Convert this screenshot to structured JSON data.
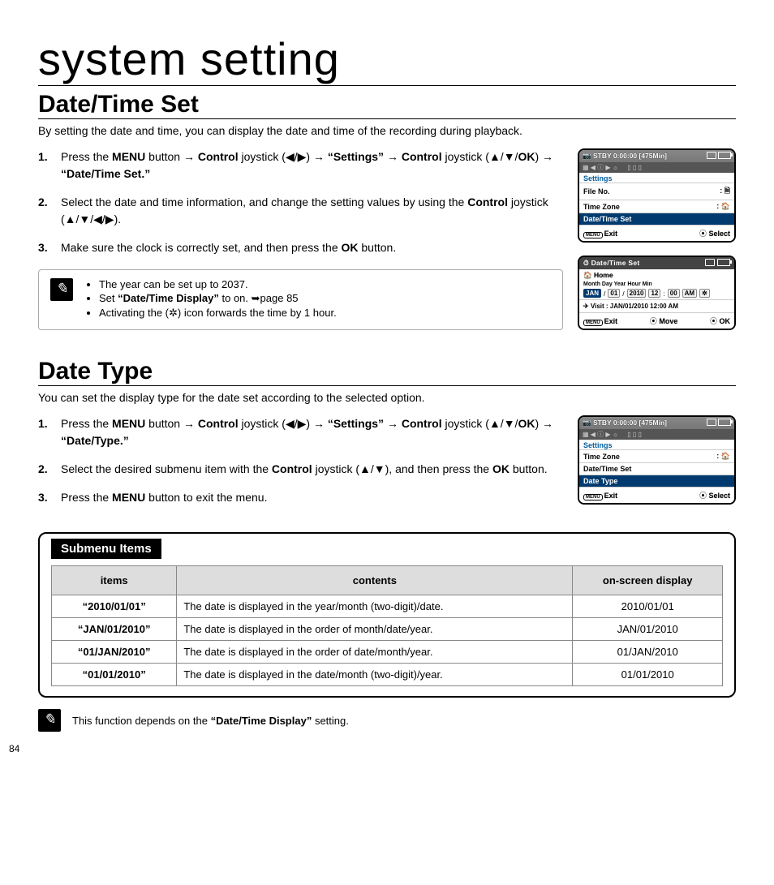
{
  "page_number": "84",
  "page_title": "system setting",
  "section1": {
    "title": "Date/Time Set",
    "intro": "By setting the date and time, you can display the date and time of the recording during playback.",
    "steps": [
      "Press the <b>MENU</b> button → <b>Control</b> joystick (◀/▶) → <b>“Settings”</b> → <b>Control</b> joystick (▲/▼/<b>OK</b>) → <b>“Date/Time Set.”</b>",
      "Select the date and time information, and change the setting values by using the <b>Control</b> joystick (▲/▼/◀/▶).",
      "Make sure the clock is correctly set, and then press the <b>OK</b> button."
    ],
    "notes": [
      "The year can be set up to 2037.",
      "Set <b>“Date/Time Display”</b> to on. ➥page 85",
      "Activating the (✲) icon forwards the time by 1 hour."
    ]
  },
  "section2": {
    "title": "Date Type",
    "intro": "You can set the display type for the date set according to the selected option.",
    "steps": [
      "Press the <b>MENU</b> button → <b>Control</b> joystick (◀/▶) → <b>“Settings”</b> → <b>Control</b> joystick (▲/▼/<b>OK</b>) → <b>“Date/Type.”</b>",
      "Select the desired submenu item with the <b>Control</b> joystick (▲/▼), and then press the <b>OK</b> button.",
      "Press the <b>MENU</b> button to exit the menu."
    ]
  },
  "submenu": {
    "tab": "Submenu Items",
    "headers": [
      "items",
      "contents",
      "on-screen display"
    ],
    "rows": [
      [
        "“2010/01/01”",
        "The date is displayed in the year/month (two-digit)/date.",
        "2010/01/01"
      ],
      [
        "“JAN/01/2010”",
        "The date is displayed in the order of month/date/year.",
        "JAN/01/2010"
      ],
      [
        "“01/JAN/2010”",
        "The date is displayed in the order of date/month/year.",
        "01/JAN/2010"
      ],
      [
        "“01/01/2010”",
        "The date is displayed in the date/month (two-digit)/year.",
        "01/01/2010"
      ]
    ]
  },
  "footnote": "This function depends on the <b>“Date/Time Display”</b> setting.",
  "screens": {
    "s1": {
      "stby": "STBY 0:00:00 [475Min]",
      "settings": "Settings",
      "items": [
        "File No.",
        "Time Zone",
        "Date/Time Set"
      ],
      "selected": 2,
      "exit": "Exit",
      "select": "Select"
    },
    "s2": {
      "title": "Date/Time Set",
      "home": "Home",
      "labels": "Month Day Year Hour Min",
      "fields": [
        "JAN",
        "01",
        "2010",
        "12",
        "00",
        "AM",
        "✲"
      ],
      "visit": "Visit : JAN/01/2010 12:00 AM",
      "exit": "Exit",
      "move": "Move",
      "ok": "OK"
    },
    "s3": {
      "stby": "STBY 0:00:00 [475Min]",
      "settings": "Settings",
      "items": [
        "Time Zone",
        "Date/Time Set",
        "Date Type"
      ],
      "selected": 2,
      "exit": "Exit",
      "select": "Select"
    }
  }
}
